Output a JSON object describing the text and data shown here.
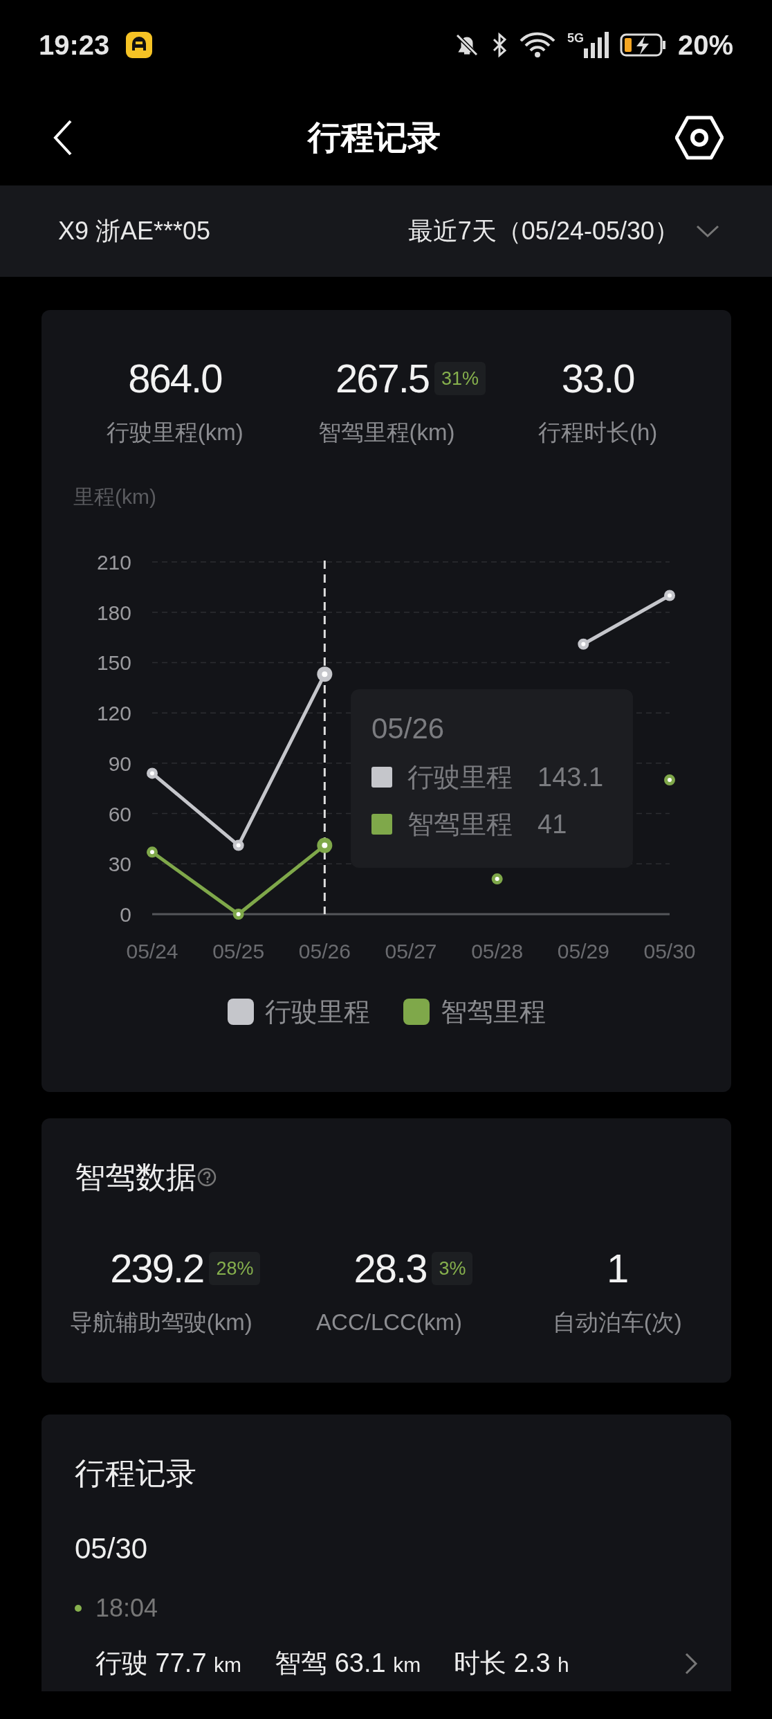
{
  "status_bar": {
    "time": "19:23",
    "network": "5G",
    "battery": "20%"
  },
  "header": {
    "title": "行程记录"
  },
  "filter": {
    "vehicle": "X9 浙AE***05",
    "range": "最近7天（05/24-05/30）"
  },
  "summary": {
    "stats": [
      {
        "value": "864.0",
        "label": "行驶里程(km)"
      },
      {
        "value": "267.5",
        "badge": "31%",
        "label": "智驾里程(km)"
      },
      {
        "value": "33.0",
        "label": "行程时长(h)"
      }
    ],
    "chart_data": {
      "type": "line",
      "ylabel": "里程(km)",
      "categories": [
        "05/24",
        "05/25",
        "05/26",
        "05/27",
        "05/28",
        "05/29",
        "05/30"
      ],
      "yticks": [
        0,
        30,
        60,
        90,
        120,
        150,
        180,
        210
      ],
      "ylim": [
        0,
        210
      ],
      "grid": true,
      "legend": true,
      "series": [
        {
          "name": "行驶里程",
          "color": "#c5c6cb",
          "marker": "circle",
          "values": [
            84,
            41,
            143.1,
            null,
            null,
            161,
            190
          ]
        },
        {
          "name": "智驾里程",
          "color": "#7fa84a",
          "marker": "circle",
          "values": [
            37,
            0,
            41,
            null,
            21,
            null,
            80
          ]
        }
      ],
      "ref_lines": [
        {
          "axis": "x",
          "value": "05/26"
        }
      ]
    },
    "tooltip": {
      "title": "05/26",
      "rows": [
        {
          "label": "行驶里程",
          "value": "143.1",
          "color": "#c5c6cb"
        },
        {
          "label": "智驾里程",
          "value": "41",
          "color": "#7fa84a"
        }
      ]
    }
  },
  "smart_driving": {
    "title": "智驾数据",
    "stats": [
      {
        "value": "239.2",
        "badge": "28%",
        "label": "导航辅助驾驶(km)"
      },
      {
        "value": "28.3",
        "badge": "3%",
        "label": "ACC/LCC(km)"
      },
      {
        "value": "1",
        "label": "自动泊车(次)"
      }
    ]
  },
  "trips": {
    "title": "行程记录",
    "days": [
      {
        "date": "05/30",
        "trips": [
          {
            "time": "18:04",
            "segments": [
              {
                "label": "行驶",
                "value": "77.7",
                "unit": "km"
              },
              {
                "label": "智驾",
                "value": "63.1",
                "unit": "km"
              },
              {
                "label": "时长",
                "value": "2.3",
                "unit": "h"
              }
            ]
          }
        ]
      }
    ]
  }
}
